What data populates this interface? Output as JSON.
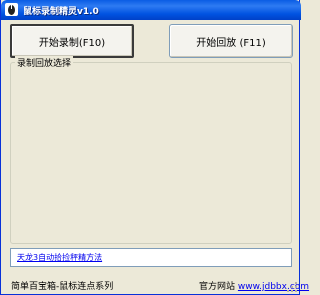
{
  "window": {
    "title": "鼠标录制精灵v1.0"
  },
  "buttons": {
    "record": "开始录制(F10)",
    "play": "开始回放 (F11)"
  },
  "group": {
    "title": "录制回放选择"
  },
  "link": {
    "text": "天龙3自动拾捡秤精方法"
  },
  "footer": {
    "series": "简单百宝箱-鼠标连点系列",
    "site_label": "官方网站",
    "site_url": "www.jdbbx.com"
  },
  "colors": {
    "titlebar": "#0A5CE4",
    "face": "#ECE9D8",
    "link": "#0000EE"
  },
  "icons": {
    "app": "mouse-app-icon",
    "grip": "resize-grip-icon"
  }
}
